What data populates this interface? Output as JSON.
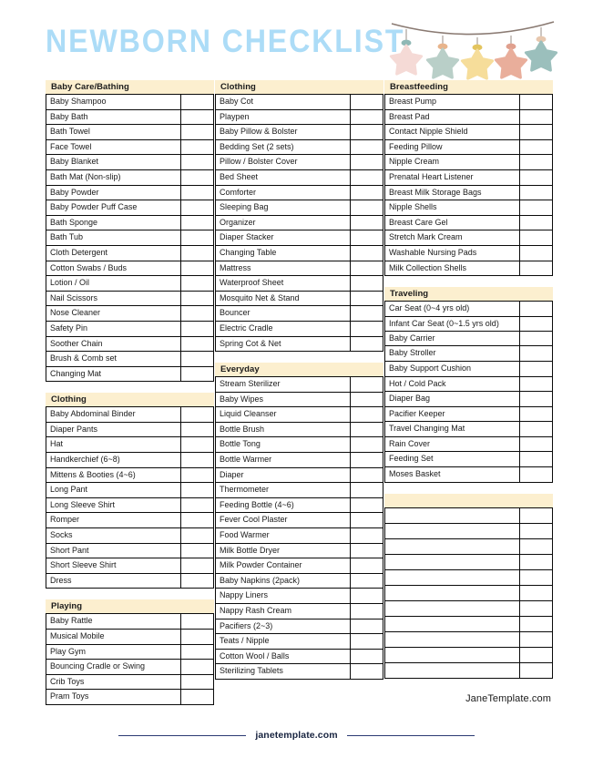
{
  "header": {
    "title": "NEWBORN CHECKLIST",
    "title_color": "#ACDCF7",
    "garland": {
      "string_color": "#8a7a72",
      "stars": [
        {
          "name": "star-pink",
          "color": "#F5DAD6",
          "bead": "#8FB8B5"
        },
        {
          "name": "star-sage",
          "color": "#B9CFC8",
          "bead": "#E8B48C"
        },
        {
          "name": "star-yellow",
          "color": "#F6DD9A",
          "bead": "#E3C45E"
        },
        {
          "name": "star-salmon",
          "color": "#E9AE9B",
          "bead": "#E0A08E"
        },
        {
          "name": "star-teal",
          "color": "#9BBFBC",
          "bead": "#E7C7AE"
        }
      ]
    }
  },
  "theme": {
    "section_header_bg": "#FCEFCF",
    "border_color": "#0a0a0a",
    "text_color": "#1a1a1a",
    "footer_color": "#17233f"
  },
  "columns": [
    {
      "name": "column-1",
      "sections": [
        {
          "title": "Baby Care/Bathing",
          "items": [
            "Baby Shampoo",
            "Baby Bath",
            "Bath Towel",
            "Face Towel",
            "Baby Blanket",
            "Bath Mat (Non-slip)",
            "Baby Powder",
            "Baby Powder Puff Case",
            "Bath Sponge",
            "Bath Tub",
            "Cloth Detergent",
            "Cotton Swabs / Buds",
            "Lotion / Oil",
            "Nail Scissors",
            "Nose Cleaner",
            "Safety Pin",
            "Soother Chain",
            "Brush & Comb set",
            "Changing Mat"
          ]
        },
        {
          "title": "Clothing",
          "items": [
            "Baby Abdominal Binder",
            "Diaper Pants",
            "Hat",
            "Handkerchief (6~8)",
            "Mittens & Booties (4~6)",
            "Long Pant",
            "Long Sleeve Shirt",
            "Romper",
            "Socks",
            "Short Pant",
            "Short Sleeve Shirt",
            "Dress"
          ]
        },
        {
          "title": "Playing",
          "items": [
            "Baby Rattle",
            "Musical Mobile",
            "Play Gym",
            "Bouncing Cradle or Swing",
            "Crib Toys",
            "Pram Toys"
          ]
        }
      ]
    },
    {
      "name": "column-2",
      "sections": [
        {
          "title": "Clothing",
          "items": [
            "Baby Cot",
            "Playpen",
            "Baby Pillow & Bolster",
            "Bedding Set (2 sets)",
            "Pillow / Bolster Cover",
            "Bed Sheet",
            "Comforter",
            "Sleeping Bag",
            "Organizer",
            "Diaper Stacker",
            "Changing Table",
            "Mattress",
            "Waterproof Sheet",
            "Mosquito Net & Stand",
            "Bouncer",
            "Electric Cradle",
            "Spring Cot & Net"
          ]
        },
        {
          "title": "Everyday",
          "items": [
            "Stream Sterilizer",
            "Baby Wipes",
            "Liquid Cleanser",
            "Bottle Brush",
            "Bottle Tong",
            "Bottle Warmer",
            "Diaper",
            "Thermometer",
            "Feeding Bottle (4~6)",
            "Fever Cool Plaster",
            "Food Warmer",
            "Milk Bottle Dryer",
            "Milk Powder Container",
            "Baby Napkins (2pack)",
            "Nappy Liners",
            "Nappy Rash Cream",
            "Pacifiers (2~3)",
            "Teats / Nipple",
            "Cotton Wool / Balls",
            "Sterilizing Tablets"
          ]
        }
      ]
    },
    {
      "name": "column-3",
      "sections": [
        {
          "title": "Breastfeeding",
          "items": [
            "Breast Pump",
            "Breast Pad",
            "Contact Nipple Shield",
            "Feeding Pillow",
            "Nipple Cream",
            "Prenatal Heart Listener",
            "Breast Milk Storage Bags",
            "Nipple Shells",
            "Breast Care Gel",
            "Stretch Mark Cream",
            "Washable Nursing Pads",
            "Milk Collection Shells"
          ]
        },
        {
          "title": "Traveling",
          "items": [
            "Car Seat (0~4 yrs old)",
            "Infant Car Seat (0~1.5 yrs old)",
            "Baby Carrier",
            "Baby Stroller",
            "Baby Support Cushion",
            "Hot / Cold Pack",
            "Diaper Bag",
            "Pacifier Keeper",
            "Travel Changing Mat",
            "Rain Cover",
            "Feeding Set",
            "Moses Basket"
          ]
        },
        {
          "title": "",
          "blank_header": true,
          "blank_rows": 11,
          "items": []
        }
      ],
      "watermark": "JaneTemplate.com"
    }
  ],
  "footer": {
    "site": "janetemplate.com"
  }
}
